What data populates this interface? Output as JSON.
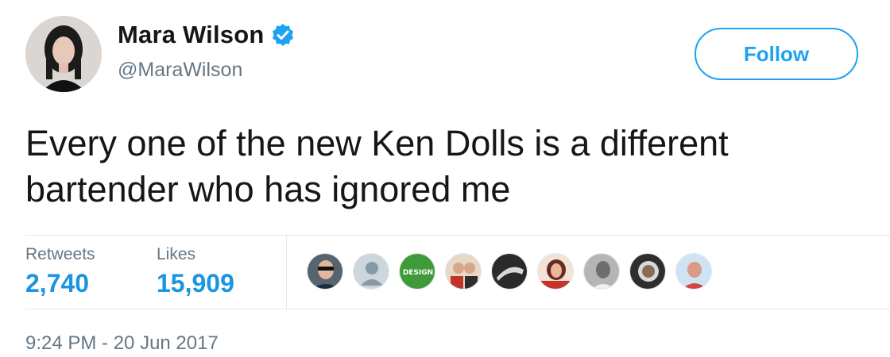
{
  "tweet": {
    "author": {
      "name": "Mara Wilson",
      "handle": "@MaraWilson",
      "verified_icon": "verified-badge-icon"
    },
    "follow_label": "Follow",
    "text": "Every one of the new Ken Dolls is a different bartender who has ignored me",
    "stats": {
      "retweets_label": "Retweets",
      "retweets_value": "2,740",
      "likes_label": "Likes",
      "likes_value": "15,909"
    },
    "liker_avatars": [
      {
        "name": "liker-avatar-1",
        "color": "#4a5a66"
      },
      {
        "name": "liker-avatar-2-default",
        "color": "#c5ced6"
      },
      {
        "name": "liker-avatar-3-design",
        "color": "#3f9b3a",
        "text": "DESIGN"
      },
      {
        "name": "liker-avatar-4",
        "color": "#b84a44"
      },
      {
        "name": "liker-avatar-5",
        "color": "#3a3a3a"
      },
      {
        "name": "liker-avatar-6",
        "color": "#8b2f2a"
      },
      {
        "name": "liker-avatar-7",
        "color": "#9a9a9a"
      },
      {
        "name": "liker-avatar-8",
        "color": "#2e2e2e"
      },
      {
        "name": "liker-avatar-9",
        "color": "#d4877a"
      }
    ],
    "timestamp": "9:24 PM - 20 Jun 2017",
    "colors": {
      "accent": "#1da1f2",
      "stat_value": "#1b95e0",
      "muted": "#657786",
      "text": "#14171a"
    }
  }
}
